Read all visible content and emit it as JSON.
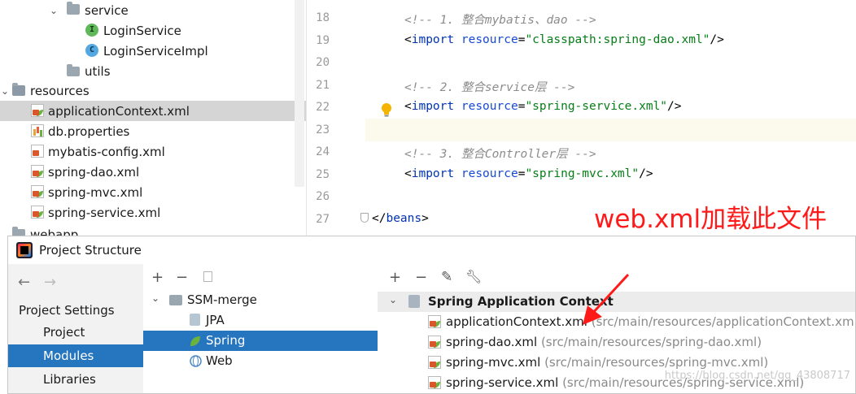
{
  "tree": {
    "items": [
      {
        "label": "service",
        "icon": "folder-icon",
        "expanded": true
      },
      {
        "label": "LoginService",
        "icon": "interface-icon",
        "badge": "I"
      },
      {
        "label": "LoginServiceImpl",
        "icon": "class-icon",
        "badge": "C"
      },
      {
        "label": "utils",
        "icon": "folder-icon"
      },
      {
        "label": "resources",
        "icon": "resources-folder-icon",
        "expanded": true
      },
      {
        "label": "applicationContext.xml",
        "icon": "spring-xml-icon",
        "selected": true
      },
      {
        "label": "db.properties",
        "icon": "properties-icon"
      },
      {
        "label": "mybatis-config.xml",
        "icon": "xml-icon"
      },
      {
        "label": "spring-dao.xml",
        "icon": "spring-xml-icon"
      },
      {
        "label": "spring-mvc.xml",
        "icon": "spring-xml-icon"
      },
      {
        "label": "spring-service.xml",
        "icon": "spring-xml-icon"
      },
      {
        "label": "webapp",
        "icon": "folder-icon"
      }
    ]
  },
  "editor": {
    "lines": [
      {
        "num": "18",
        "comment": "<!-- 1. 整合mybatis、dao -->"
      },
      {
        "num": "19",
        "tag": "import",
        "attr": "resource",
        "value": "\"classpath:spring-dao.xml\""
      },
      {
        "num": "20"
      },
      {
        "num": "21",
        "comment": "<!-- 2. 整合service层 -->"
      },
      {
        "num": "22",
        "tag": "import",
        "attr": "resource",
        "value": "\"spring-service.xml\""
      },
      {
        "num": "23"
      },
      {
        "num": "24",
        "comment": "<!-- 3. 整合Controller层 -->"
      },
      {
        "num": "25",
        "tag": "import",
        "attr": "resource",
        "value": "\"spring-mvc.xml\""
      },
      {
        "num": "26"
      },
      {
        "num": "27",
        "closing": "beans"
      }
    ],
    "annotation": "web.xml加载此文件",
    "annotation_color": "#ff1a1a"
  },
  "dialog": {
    "title": "Project Structure",
    "left": {
      "back_icon": "arrow-left-icon",
      "forward_icon": "arrow-right-icon",
      "heading": "Project Settings",
      "items": [
        {
          "label": "Project"
        },
        {
          "label": "Modules",
          "active": true
        },
        {
          "label": "Libraries"
        }
      ]
    },
    "middle": {
      "toolbar": [
        "add-icon",
        "remove-icon",
        "copy-icon"
      ],
      "module": "SSM-merge",
      "facets": [
        {
          "label": "JPA",
          "icon": "jpa-icon"
        },
        {
          "label": "Spring",
          "icon": "spring-leaf-icon",
          "active": true
        },
        {
          "label": "Web",
          "icon": "web-icon"
        }
      ]
    },
    "right": {
      "toolbar": [
        "add-icon",
        "remove-icon",
        "edit-icon",
        "wrench-icon"
      ],
      "context_title": "Spring Application Context",
      "files": [
        {
          "name": "applicationContext.xml",
          "path": "(src/main/resources/applicationContext.xml)"
        },
        {
          "name": "spring-dao.xml",
          "path": "(src/main/resources/spring-dao.xml)"
        },
        {
          "name": "spring-mvc.xml",
          "path": "(src/main/resources/spring-mvc.xml)"
        },
        {
          "name": "spring-service.xml",
          "path": "(src/main/resources/spring-service.xml)"
        }
      ],
      "watermark": "https://blog.csdn.net/qq_43808717"
    }
  },
  "colors": {
    "selection": "#2675bf",
    "tag": "#0033b3",
    "string": "#067d17",
    "comment": "#8c8c8c"
  }
}
